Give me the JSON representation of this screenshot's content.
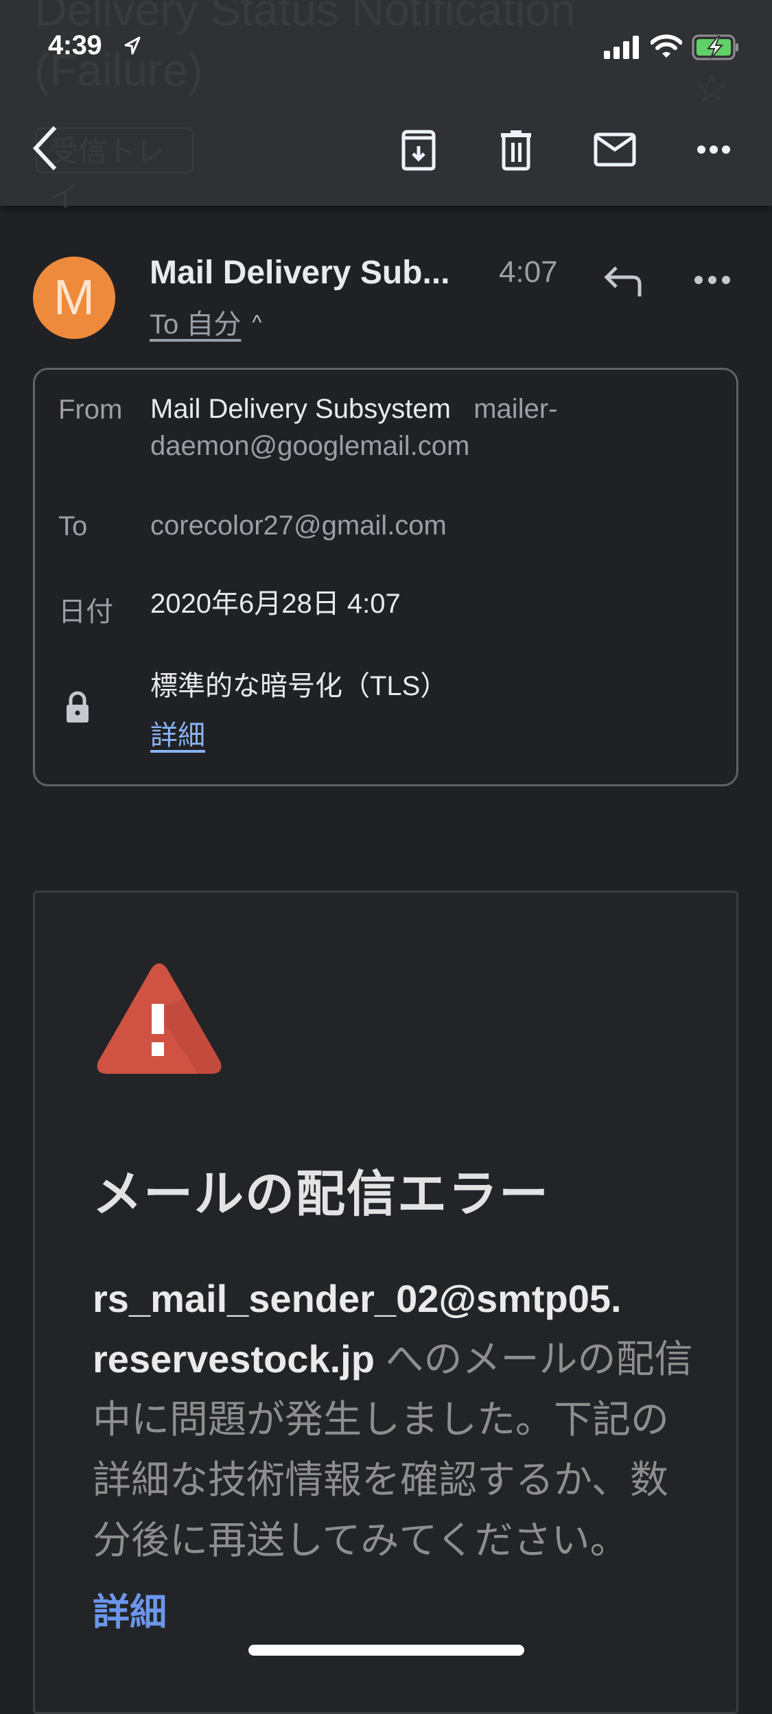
{
  "status_bar": {
    "time": "4:39",
    "location_icon": "location-arrow-icon",
    "signal_icon": "cellular-signal-icon",
    "wifi_icon": "wifi-icon",
    "battery_icon": "battery-charging-icon",
    "battery_color": "#4cd964"
  },
  "header": {
    "subject_ghost": "Delivery Status Notification (Failure)",
    "back_label_ghost": "受信トレイ",
    "star_ghost": "☆",
    "actions": [
      {
        "name": "archive",
        "icon": "archive-icon"
      },
      {
        "name": "delete",
        "icon": "trash-icon"
      },
      {
        "name": "mark-unread",
        "icon": "mail-icon"
      },
      {
        "name": "more",
        "icon": "more-horizontal-icon"
      }
    ]
  },
  "message": {
    "avatar_letter": "M",
    "avatar_color": "#ee8a3b",
    "sender_display": "Mail Delivery Sub...",
    "time": "4:07",
    "to_label": "To 自分",
    "caret": "^"
  },
  "details": {
    "from_label": "From",
    "from_name": "Mail Delivery Subsystem",
    "from_email_line1": "mailer-",
    "from_email_line2": "daemon@googlemail.com",
    "to_label": "To",
    "to_value": "corecolor27@gmail.com",
    "date_label": "日付",
    "date_value": "2020年6月28日 4:07",
    "security_value": "標準的な暗号化（TLS）",
    "security_link": "詳細"
  },
  "error_card": {
    "title": "メールの配信エラー",
    "address_line1": "rs_mail_sender_02@smtp05.",
    "address_line2": "reservestock.jp",
    "body_text": " へのメールの配信中に問題が発生しました。下記の詳細な技術情報を確認するか、数分後に再送してみてください。",
    "details_link": "詳細",
    "icon_color": "#d04f3f",
    "link_color": "#6c96ec"
  }
}
